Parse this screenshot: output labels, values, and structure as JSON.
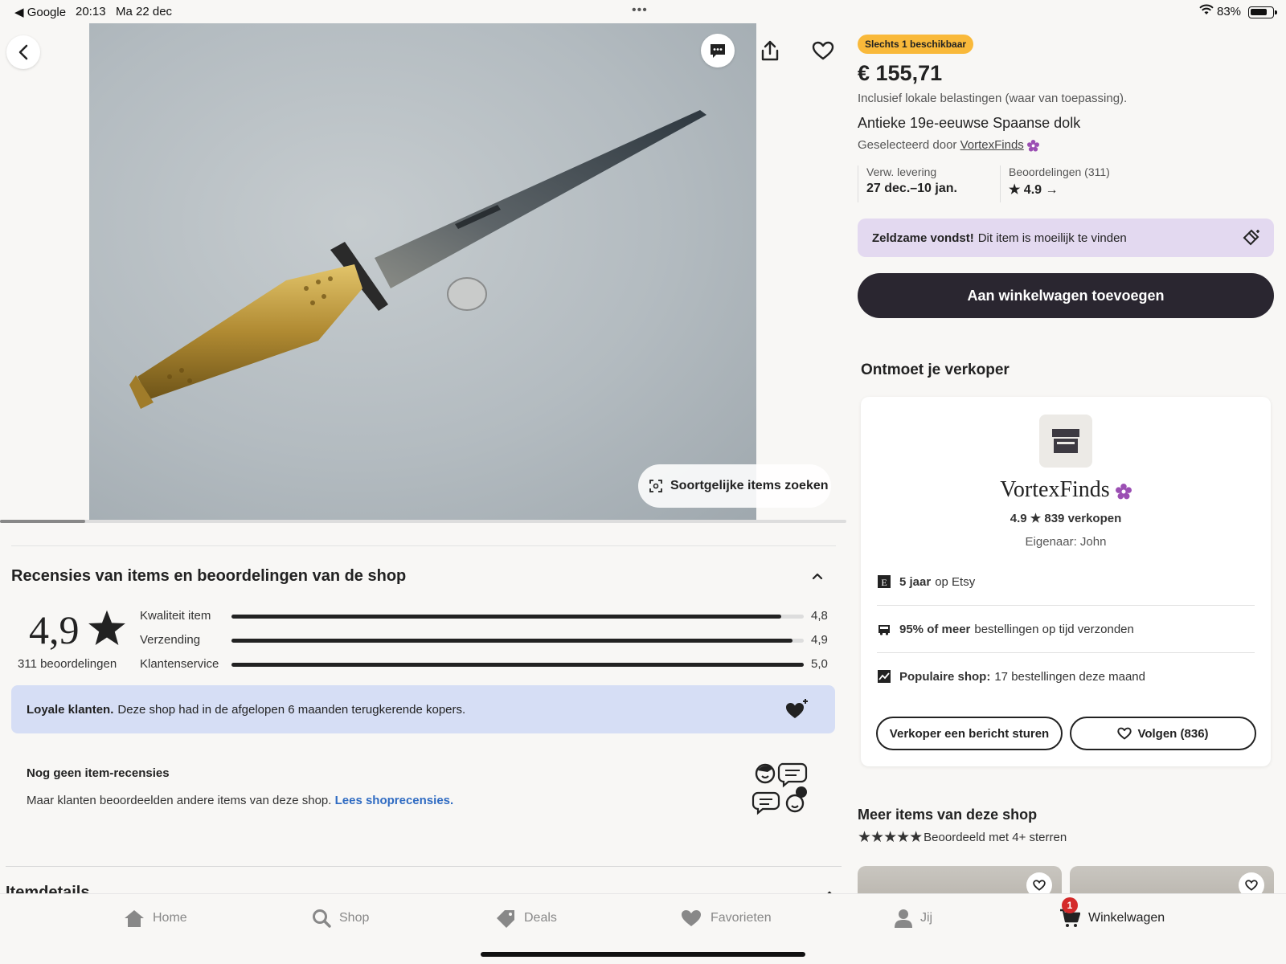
{
  "status_bar": {
    "back_app": "◀ Google",
    "time": "20:13",
    "date": "Ma 22 dec",
    "battery_percent": "83%",
    "battery_level": 0.83,
    "dots": "•••"
  },
  "product": {
    "stock_badge": "Slechts 1 beschikbaar",
    "price": "€ 155,71",
    "tax_note": "Inclusief lokale belastingen (waar van toepassing).",
    "title": "Antieke 19e-eeuwse Spaanse dolk",
    "selected_by_prefix": "Geselecteerd door",
    "shop_link": "VortexFinds",
    "delivery_label": "Verw. levering",
    "delivery_value": "27 dec.–10 jan.",
    "reviews_label": "Beoordelingen (311)",
    "reviews_value": "4.9",
    "rare_strong": "Zeldzame vondst!",
    "rare_text": "Dit item is moeilijk te vinden",
    "add_to_cart": "Aan winkelwagen toevoegen",
    "similar_search": "Soortgelijke items zoeken"
  },
  "seller": {
    "section_title": "Ontmoet je verkoper",
    "shop_name": "VortexFinds",
    "stats": "4.9 ★ 839 verkopen",
    "owner": "Eigenaar: John",
    "years_strong": "5 jaar",
    "years_text": "op Etsy",
    "ontime_strong": "95% of meer",
    "ontime_text": "bestellingen op tijd verzonden",
    "popular_strong": "Populaire shop:",
    "popular_text": "17 bestellingen deze maand",
    "message_button": "Verkoper een bericht sturen",
    "follow_button": "Volgen (836)"
  },
  "more_items": {
    "title": "Meer items van deze shop",
    "subtitle": "Beoordeeld met 4+ sterren"
  },
  "reviews": {
    "section_title": "Recensies van items en beoordelingen van de shop",
    "overall": "4,9",
    "count": "311 beoordelingen",
    "bars": [
      {
        "label": "Kwaliteit item",
        "value": "4,8",
        "score": 4.8
      },
      {
        "label": "Verzending",
        "value": "4,9",
        "score": 4.9
      },
      {
        "label": "Klantenservice",
        "value": "5,0",
        "score": 5.0
      }
    ],
    "loyal_strong": "Loyale klanten.",
    "loyal_text": "Deze shop had in de afgelopen 6 maanden terugkerende kopers.",
    "no_reviews_title": "Nog geen item-recensies",
    "no_reviews_text": "Maar klanten beoordeelden andere items van deze shop.",
    "no_reviews_link": "Lees shoprecensies.",
    "item_details": "Itemdetails"
  },
  "tabs": [
    {
      "label": "Home",
      "icon": "home-icon"
    },
    {
      "label": "Shop",
      "icon": "search-icon"
    },
    {
      "label": "Deals",
      "icon": "tag-icon"
    },
    {
      "label": "Favorieten",
      "icon": "heart-icon"
    },
    {
      "label": "Jij",
      "icon": "person-icon"
    },
    {
      "label": "Winkelwagen",
      "icon": "cart-icon"
    }
  ],
  "cart_badge": "1",
  "colors": {
    "accent_dark": "#2a2630",
    "badge_yellow": "#f9b93a",
    "rare_purple": "#e3d9f0",
    "loyal_blue": "#d6def5",
    "link_blue": "#2f6bc2",
    "star_seller": "#9b4fb3"
  }
}
